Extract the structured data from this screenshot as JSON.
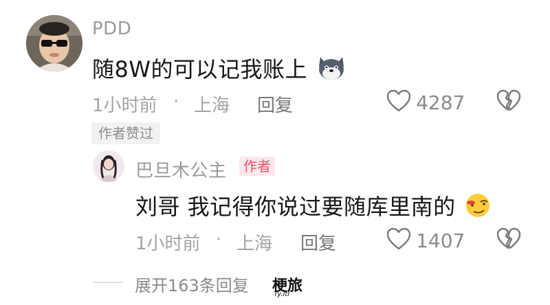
{
  "comment": {
    "username": "PDD",
    "content": "随8W的可以记我账上",
    "emoji_icon": "wolf-emoji-icon",
    "time": "1小时前",
    "separator": "·",
    "location": "上海",
    "reply_label": "回复",
    "like_count": "4287",
    "author_liked_label": "作者赞过"
  },
  "reply": {
    "username": "巴旦木公主",
    "author_badge": "作者",
    "content": "刘哥 我记得你说过要随库里南的",
    "emoji_icon": "smirk-emoji-icon",
    "time": "1小时前",
    "separator": "·",
    "location": "上海",
    "reply_label": "回复",
    "like_count": "1407"
  },
  "expand": {
    "label": "展开163条回复"
  },
  "watermark": {
    "text": "梗旅",
    "sub": "Ty.ltl"
  },
  "colors": {
    "author_badge_bg": "#fde7ea",
    "author_badge_text": "#f0536c",
    "meta_text": "#a3a3a3"
  }
}
